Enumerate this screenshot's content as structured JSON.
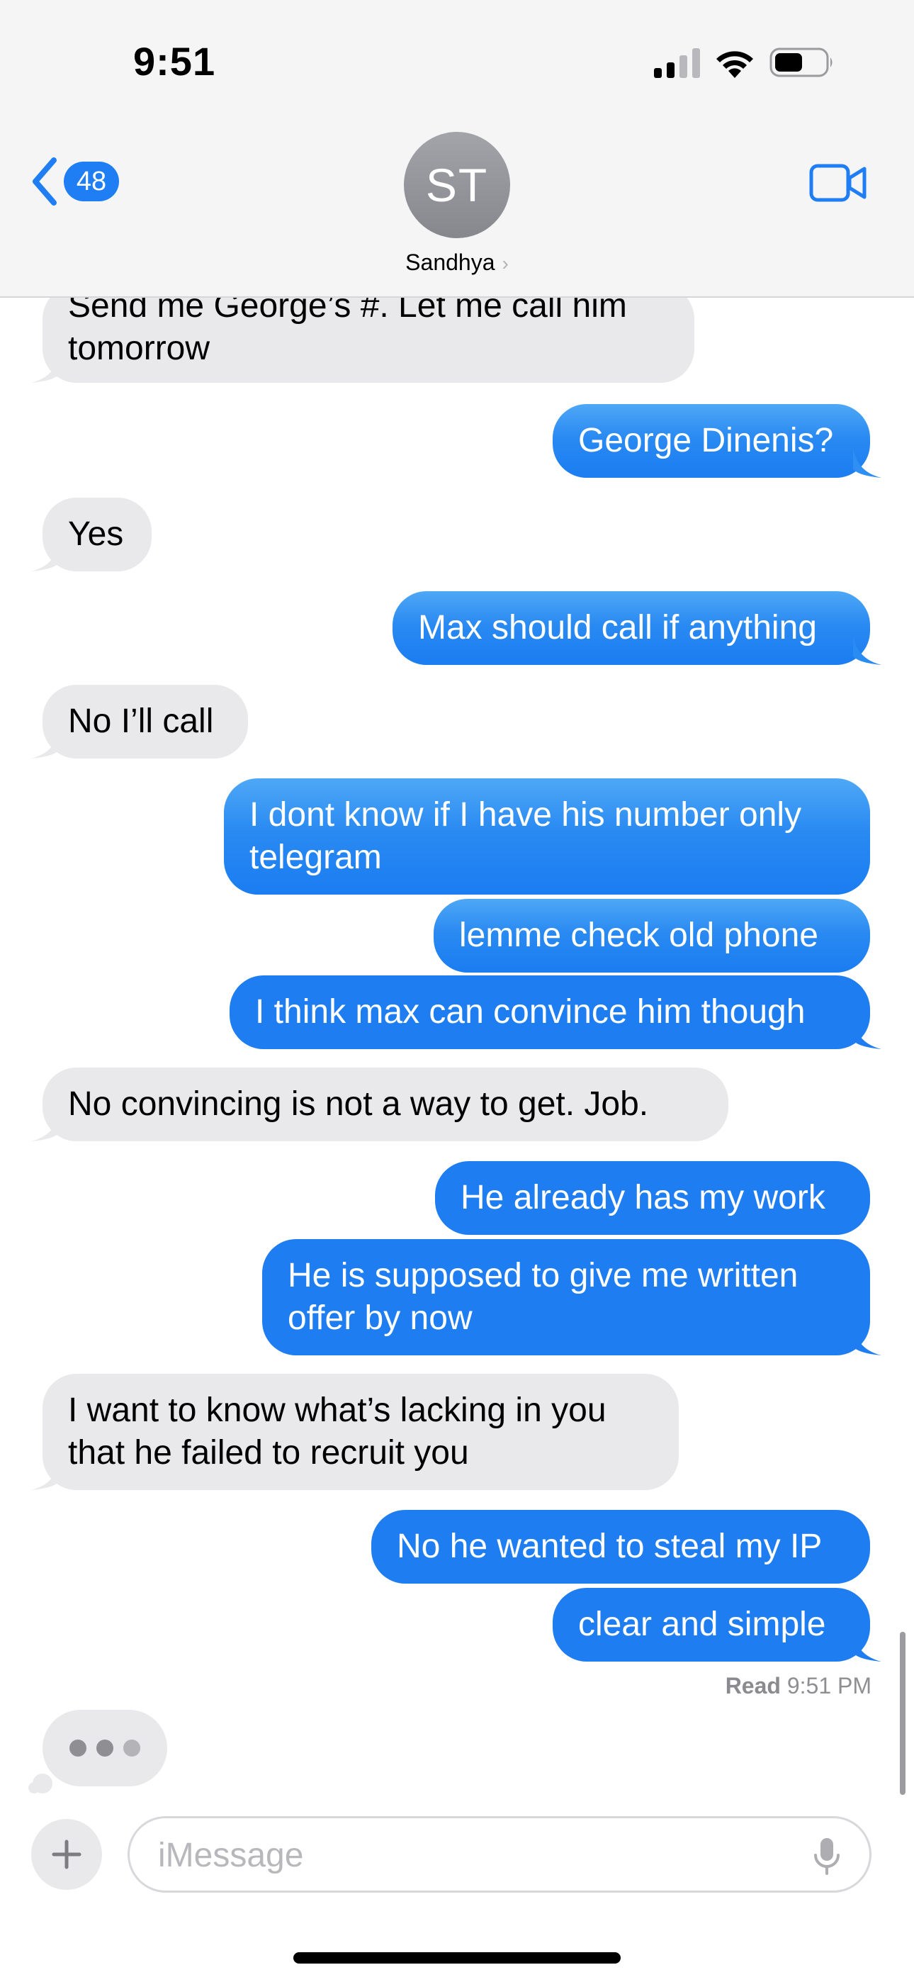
{
  "status_bar": {
    "time": "9:51"
  },
  "nav": {
    "back_count": "48",
    "avatar_initials": "ST",
    "contact_name": "Sandhya",
    "contact_chevron": "›"
  },
  "messages": [
    {
      "from": "them",
      "text": "Send me George’s #. Let me call him\ntomorrow"
    },
    {
      "from": "me",
      "text": "George Dinenis?"
    },
    {
      "from": "them",
      "text": "Yes"
    },
    {
      "from": "me",
      "text": "Max should call if anything"
    },
    {
      "from": "them",
      "text": "No I’ll call"
    },
    {
      "from": "me",
      "text": "I dont know if I have his number only\ntelegram"
    },
    {
      "from": "me",
      "text": "lemme check old phone"
    },
    {
      "from": "me",
      "text": "I think max can convince him though"
    },
    {
      "from": "them",
      "text": "No convincing is not a way to get. Job."
    },
    {
      "from": "me",
      "text": "He already has my work"
    },
    {
      "from": "me",
      "text": "He is supposed to give me written\noffer by now"
    },
    {
      "from": "them",
      "text": "I want to know what’s lacking in you\nthat he failed to recruit you"
    },
    {
      "from": "me",
      "text": "No he wanted to steal my IP"
    },
    {
      "from": "me",
      "text": "clear and simple"
    }
  ],
  "receipt": {
    "label": "Read",
    "time": "9:51 PM"
  },
  "composer": {
    "placeholder": "iMessage"
  },
  "colors": {
    "outgoing": "#1f7ef4",
    "incoming": "#e9e9eb",
    "accent": "#1f7ef4"
  },
  "icons": [
    "cellular-signal-icon",
    "wifi-icon",
    "battery-icon",
    "back-chevron-icon",
    "video-camera-icon",
    "plus-icon",
    "microphone-icon",
    "typing-indicator-icon"
  ]
}
